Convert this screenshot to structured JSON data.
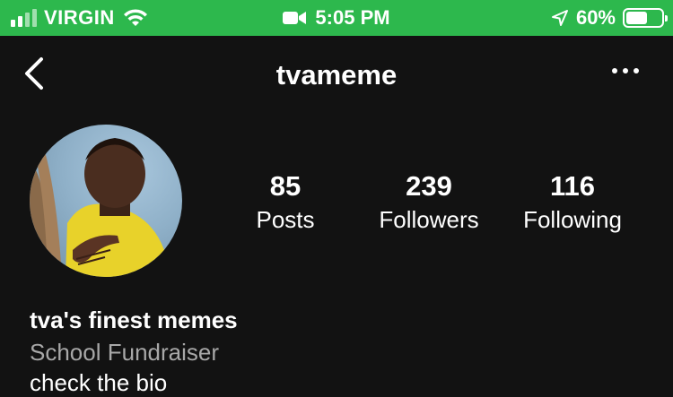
{
  "status_bar": {
    "carrier": "VIRGIN",
    "time": "5:05 PM",
    "battery_percent": "60%",
    "battery_level": 0.6,
    "signal_bars": 2,
    "background_color": "#2db84d",
    "icons": [
      "signal-icon",
      "wifi-icon",
      "facetime-camera-icon",
      "location-arrow-icon",
      "battery-icon"
    ]
  },
  "header": {
    "username": "tvameme",
    "icons": [
      "back-chevron-icon",
      "more-dots-icon"
    ]
  },
  "profile": {
    "stats": [
      {
        "value": "85",
        "label": "Posts"
      },
      {
        "value": "239",
        "label": "Followers"
      },
      {
        "value": "116",
        "label": "Following"
      }
    ],
    "bio": {
      "name": "tva's finest memes",
      "category": "School Fundraiser",
      "line": "check the bio"
    }
  },
  "colors": {
    "background": "#121212",
    "text": "#ffffff",
    "secondary_text": "#a8a8a8"
  }
}
